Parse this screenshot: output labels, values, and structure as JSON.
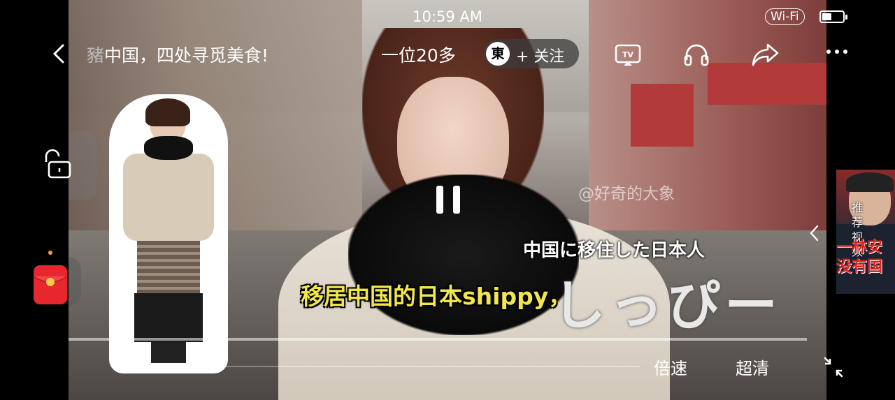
{
  "status_bar": {
    "time": "10:59 AM",
    "wifi": "Wi-Fi",
    "battery_level": 0.45
  },
  "top_bar": {
    "title_prefix": "豬",
    "title": "中国，四处寻觅美食!",
    "title_continued": "一位20多",
    "channel_logo": "東",
    "follow_label": "+ 关注"
  },
  "video": {
    "watermark": "@好奇的大象",
    "caption_jp": "中国に移住した日本人",
    "caption_jp_large": "しっぴー",
    "subtitle": "移居中国的日本shippy，",
    "progress": 0.0
  },
  "controls": {
    "speed_label": "倍速",
    "quality_label": "超清"
  },
  "recommendation": {
    "label": "推荐视频",
    "title_line1": "一林安",
    "title_line2": "没有国"
  },
  "colors": {
    "subtitle": "#f2e64b",
    "red_packet": "#e8262d",
    "accent_dot": "#f5a623"
  }
}
